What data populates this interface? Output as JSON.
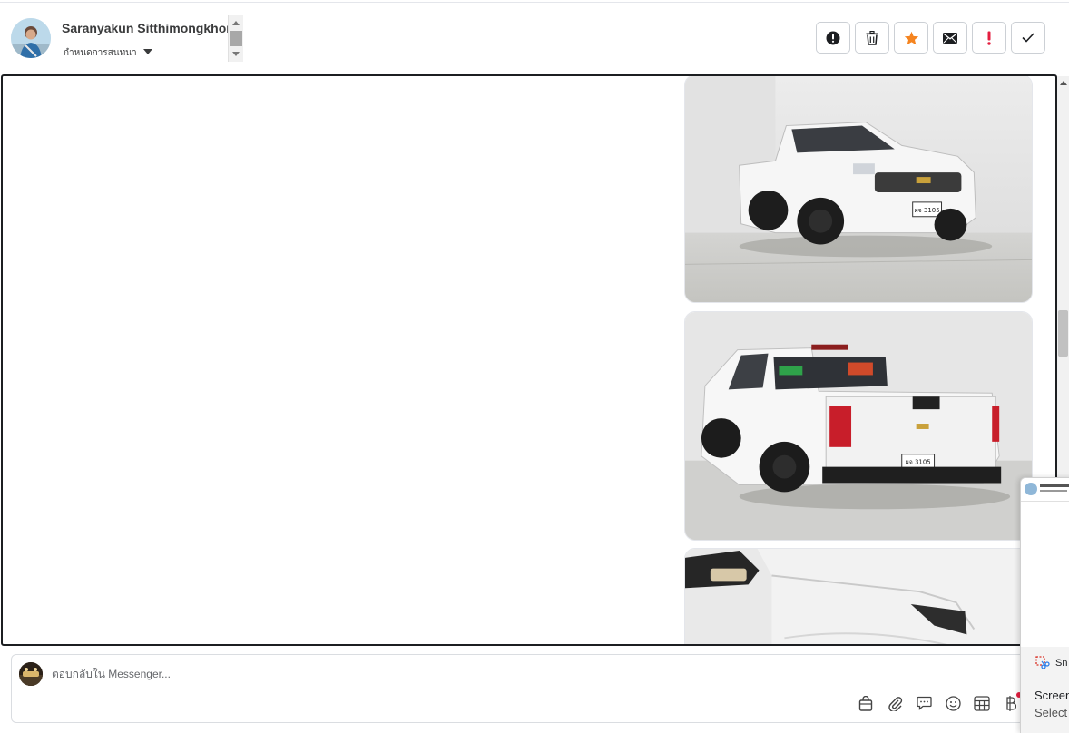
{
  "header": {
    "contact_name": "Saranyakun Sitthimongkhon",
    "assign_label": "กำหนดการสนทนา",
    "actions": [
      {
        "name": "spam-button",
        "icon": "exclamation-circle-icon"
      },
      {
        "name": "delete-button",
        "icon": "trash-icon"
      },
      {
        "name": "star-button",
        "icon": "star-icon",
        "color": "#f5841f"
      },
      {
        "name": "mark-unread-button",
        "icon": "envelope-icon"
      },
      {
        "name": "follow-up-button",
        "icon": "exclamation-icon",
        "color": "#e41e3f"
      },
      {
        "name": "mark-done-button",
        "icon": "check-icon"
      }
    ]
  },
  "conversation": {
    "attachments": [
      {
        "name": "photo-truck-front",
        "subject": "white pickup truck front three-quarter view",
        "plate": "ผจ 3105"
      },
      {
        "name": "photo-truck-rear",
        "subject": "white pickup truck rear three-quarter view",
        "plate": "ผจ 3105"
      },
      {
        "name": "photo-truck-side",
        "subject": "white pickup truck side mirror close-up"
      }
    ]
  },
  "composer": {
    "placeholder": "ตอบกลับใน Messenger...",
    "tools": [
      "shopping-bag-icon",
      "paperclip-icon",
      "saved-reply-icon",
      "emoji-icon",
      "table-icon",
      "baht-icon"
    ]
  },
  "snip_notification": {
    "app_name": "Sn",
    "title": "Screen",
    "subtitle": "Select"
  }
}
